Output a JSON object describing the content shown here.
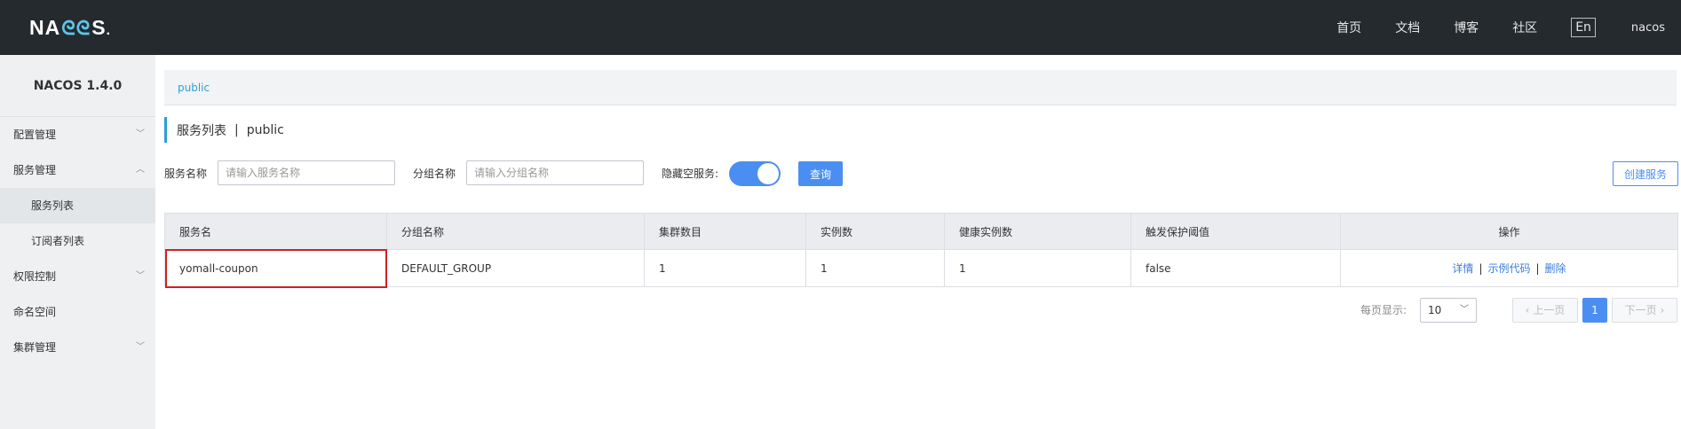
{
  "header": {
    "logo_text": "NACOS.",
    "nav": [
      "首页",
      "文档",
      "博客",
      "社区"
    ],
    "lang": "En",
    "username": "nacos"
  },
  "sidebar": {
    "title": "NACOS 1.4.0",
    "items": [
      {
        "label": "配置管理",
        "expanded": false
      },
      {
        "label": "服务管理",
        "expanded": true
      },
      {
        "label": "服务列表",
        "sub": true,
        "active": true
      },
      {
        "label": "订阅者列表",
        "sub": true
      },
      {
        "label": "权限控制",
        "expanded": false
      },
      {
        "label": "命名空间"
      },
      {
        "label": "集群管理",
        "expanded": false
      }
    ]
  },
  "breadcrumb": {
    "namespace": "public"
  },
  "page": {
    "title": "服务列表",
    "namespace": "public"
  },
  "filters": {
    "service_name_label": "服务名称",
    "service_name_placeholder": "请输入服务名称",
    "group_name_label": "分组名称",
    "group_name_placeholder": "请输入分组名称",
    "hide_empty_label": "隐藏空服务:",
    "hide_empty_on": true,
    "query_button": "查询",
    "create_button": "创建服务"
  },
  "table": {
    "columns": [
      "服务名",
      "分组名称",
      "集群数目",
      "实例数",
      "健康实例数",
      "触发保护阈值",
      "操作"
    ],
    "rows": [
      {
        "service": "yomall-coupon",
        "group": "DEFAULT_GROUP",
        "clusters": "1",
        "instances": "1",
        "healthy": "1",
        "threshold": "false",
        "actions": [
          "详情",
          "示例代码",
          "删除"
        ]
      }
    ]
  },
  "pagination": {
    "page_size_label": "每页显示:",
    "page_size": "10",
    "prev": "上一页",
    "next": "下一页",
    "current": "1"
  },
  "colors": {
    "accent": "#4a8ef2",
    "topbar": "#252a2f",
    "highlight": "#d42020"
  }
}
